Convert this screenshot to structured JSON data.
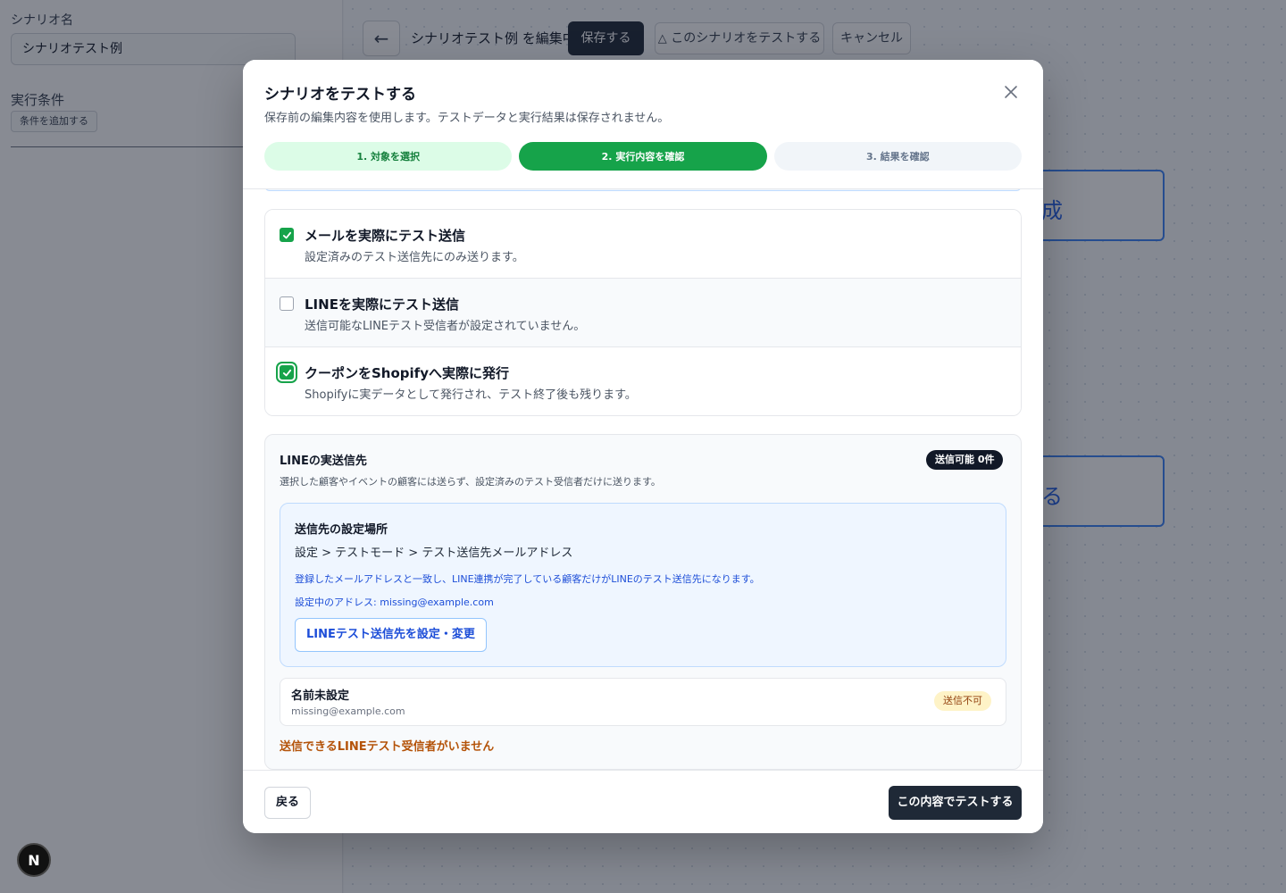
{
  "background": {
    "sidebar": {
      "scenario_name_label": "シナリオ名",
      "scenario_name_value": "シナリオテスト例",
      "conditions_label": "実行条件",
      "add_condition_button": "条件を追加する"
    },
    "toolbar": {
      "title": "シナリオテスト例 を編集中",
      "save_button": "保存する",
      "test_button": "このシナリオをテストする",
      "cancel_button": "キャンセル"
    },
    "nodes": {
      "node1_text": "成",
      "node2_text": "る"
    }
  },
  "modal": {
    "title": "シナリオをテストする",
    "subtitle": "保存前の編集内容を使用します。テストデータと実行結果は保存されません。",
    "steps": [
      {
        "label": "1. 対象を選択",
        "state": "done"
      },
      {
        "label": "2. 実行内容を確認",
        "state": "active"
      },
      {
        "label": "3. 結果を確認",
        "state": "todo"
      }
    ],
    "options": [
      {
        "title": "メールを実際にテスト送信",
        "description": "設定済みのテスト送信先にのみ送ります。",
        "checked": true,
        "disabled": false
      },
      {
        "title": "LINEを実際にテスト送信",
        "description": "送信可能なLINEテスト受信者が設定されていません。",
        "checked": false,
        "disabled": true
      },
      {
        "title": "クーポンをShopifyへ実際に発行",
        "description": "Shopifyに実データとして発行され、テスト終了後も残ります。",
        "checked": true,
        "disabled": false
      }
    ],
    "line_recipients": {
      "title": "LINEの実送信先",
      "description": "選択した顧客やイベントの顧客には送らず、設定済みのテスト受信者だけに送ります。",
      "count_badge": "送信可能 0件",
      "info": {
        "title": "送信先の設定場所",
        "path": "設定 > テストモード > テスト送信先メールアドレス",
        "description": "登録したメールアドレスと一致し、LINE連携が完了している顧客だけがLINEのテスト送信先になります。",
        "address_label": "設定中のアドレス:",
        "address_value": "missing@example.com",
        "button": "LINEテスト送信先を設定・変更"
      },
      "recipient": {
        "name": "名前未設定",
        "email": "missing@example.com",
        "status": "送信不可"
      },
      "warning": "送信できるLINEテスト受信者がいません"
    },
    "footer": {
      "back_button": "戻る",
      "run_button": "この内容でテストする"
    }
  },
  "colors": {
    "primary_green": "#16a34a",
    "dark": "#1f2937",
    "info_blue": "#1d4ed8",
    "warning": "#b45309"
  }
}
